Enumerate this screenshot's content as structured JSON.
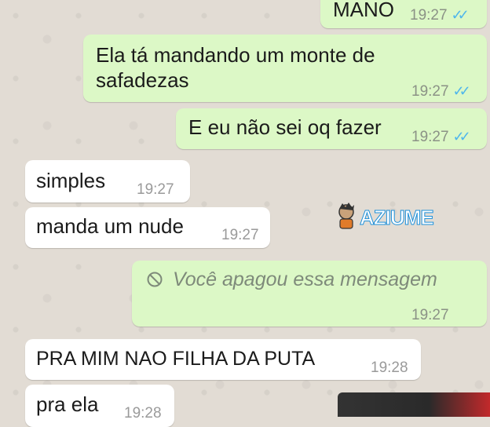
{
  "messages": [
    {
      "text": "MANO",
      "time": "19:27",
      "ticks": "✓✓",
      "dir": "out"
    },
    {
      "text_line1": "Ela tá mandando um monte de",
      "text_line2": "safadezas",
      "time": "19:27",
      "ticks": "✓✓",
      "dir": "out"
    },
    {
      "text": "E eu não sei oq fazer",
      "time": "19:27",
      "ticks": "✓✓",
      "dir": "out"
    },
    {
      "text": "simples",
      "time": "19:27",
      "dir": "in"
    },
    {
      "text": "manda um nude",
      "time": "19:27",
      "dir": "in"
    },
    {
      "text": "Você apagou essa mensagem",
      "time": "19:27",
      "dir": "out",
      "deleted": true
    },
    {
      "text": "PRA MIM NAO FILHA DA PUTA",
      "time": "19:28",
      "dir": "in"
    },
    {
      "text": "pra ela",
      "time": "19:28",
      "dir": "in"
    }
  ],
  "watermark": {
    "text": "AZIUME"
  },
  "colors": {
    "outgoing": "#dcf8c6",
    "incoming": "#ffffff",
    "read_ticks": "#4fb6ec",
    "wallpaper": "#e2dcd4"
  }
}
